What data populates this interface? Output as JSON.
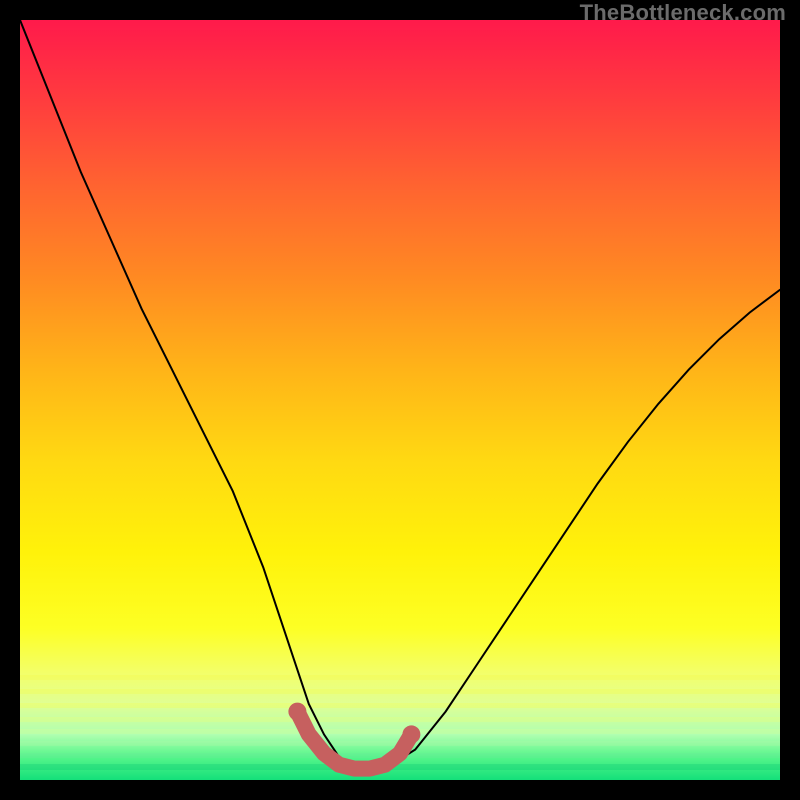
{
  "watermark": {
    "text": "TheBottleneck.com"
  },
  "chart_data": {
    "type": "line",
    "title": "",
    "xlabel": "",
    "ylabel": "",
    "xlim": [
      0,
      100
    ],
    "ylim": [
      0,
      100
    ],
    "grid": false,
    "legend": false,
    "background_gradient": {
      "top": "#ff1a4b",
      "mid": "#fff20a",
      "bottom": "#14e07a"
    },
    "series": [
      {
        "name": "bottleneck-curve",
        "color": "#000000",
        "x": [
          0,
          4,
          8,
          12,
          16,
          20,
          24,
          28,
          32,
          34,
          36,
          38,
          40,
          42,
          44,
          46,
          48,
          52,
          56,
          60,
          64,
          68,
          72,
          76,
          80,
          84,
          88,
          92,
          96,
          100
        ],
        "y": [
          100,
          90,
          80,
          71,
          62,
          54,
          46,
          38,
          28,
          22,
          16,
          10,
          6,
          3,
          1.5,
          1,
          1.5,
          4,
          9,
          15,
          21,
          27,
          33,
          39,
          44.5,
          49.5,
          54,
          58,
          61.5,
          64.5
        ]
      },
      {
        "name": "bottleneck-dip-highlight",
        "color": "#c6605f",
        "x": [
          36.5,
          38,
          40,
          42,
          44,
          46,
          48,
          50,
          51.5
        ],
        "y": [
          9,
          6,
          3.5,
          2,
          1.5,
          1.5,
          2,
          3.5,
          6
        ]
      }
    ]
  }
}
